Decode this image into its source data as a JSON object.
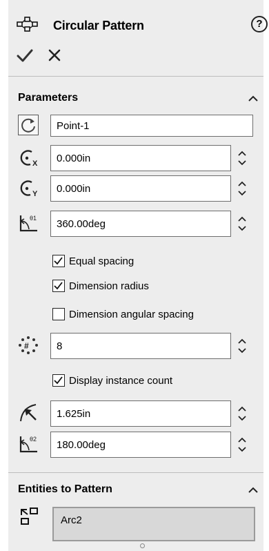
{
  "header": {
    "title": "Circular Pattern",
    "help_symbol": "?",
    "ok_icon": "checkmark-icon",
    "cancel_icon": "x-icon"
  },
  "parameters": {
    "section_title": "Parameters",
    "reference_axis": {
      "value": "Point-1"
    },
    "center_x": {
      "value": "0.000in"
    },
    "center_y": {
      "value": "0.000in"
    },
    "angle": {
      "value": "360.00deg"
    },
    "equal_spacing": {
      "label": "Equal spacing",
      "checked": true
    },
    "dimension_radius": {
      "label": "Dimension radius",
      "checked": true
    },
    "dimension_angular_spacing": {
      "label": "Dimension angular spacing",
      "checked": false
    },
    "instances": {
      "value": "8"
    },
    "display_instance_count": {
      "label": "Display instance count",
      "checked": true
    },
    "radius": {
      "value": "1.625in"
    },
    "angle2": {
      "value": "180.00deg"
    }
  },
  "entities": {
    "section_title": "Entities to Pattern",
    "items": [
      "Arc2"
    ]
  }
}
